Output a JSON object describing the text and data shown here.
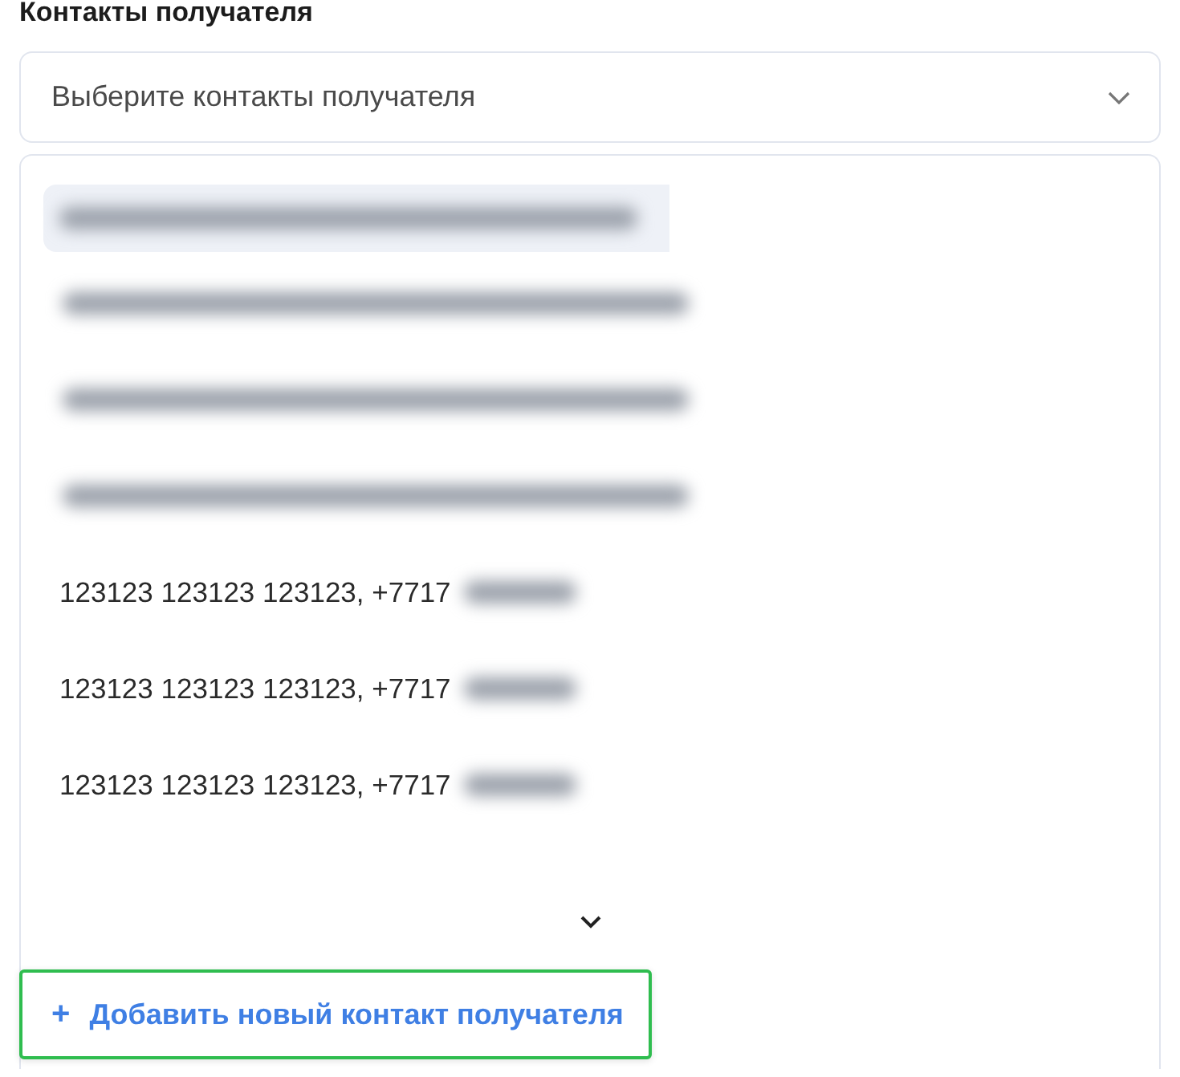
{
  "field": {
    "label": "Контакты получателя",
    "placeholder": "Выберите контакты получателя"
  },
  "options": [
    {
      "kind": "redacted",
      "highlighted": true
    },
    {
      "kind": "redacted",
      "highlighted": false
    },
    {
      "kind": "redacted",
      "highlighted": false
    },
    {
      "kind": "redacted",
      "highlighted": false
    },
    {
      "kind": "text",
      "text": "123123 123123 123123, +7717",
      "highlighted": false
    },
    {
      "kind": "text",
      "text": "123123 123123 123123, +7717",
      "highlighted": false
    },
    {
      "kind": "text",
      "text": "123123 123123 123123, +7717",
      "highlighted": false
    }
  ],
  "add_button": {
    "icon": "+",
    "label": "Добавить новый контакт получателя"
  }
}
